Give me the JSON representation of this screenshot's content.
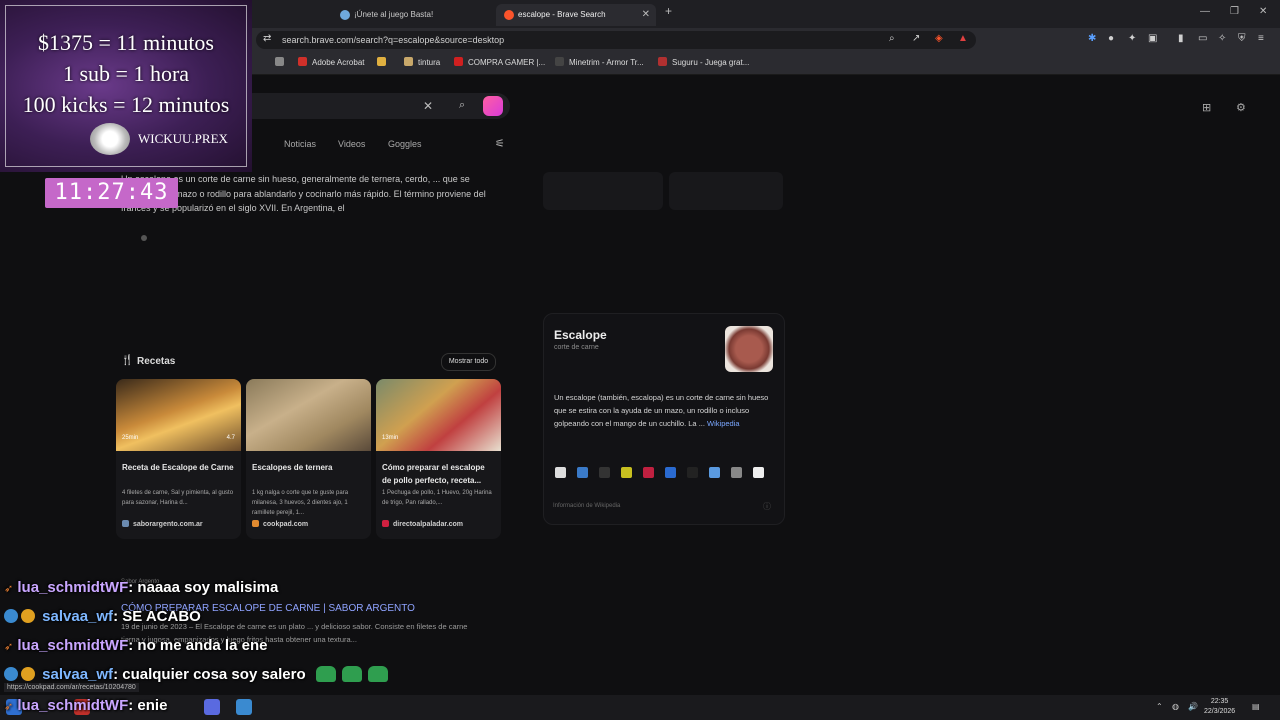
{
  "browser": {
    "tabs": [
      {
        "title": "¡Únete al juego Basta!",
        "active": false
      },
      {
        "title": "escalope - Brave Search",
        "active": true
      }
    ],
    "url": "search.brave.com/search?q=escalope&source=desktop",
    "bookmarks": [
      "Adobe Acrobat",
      "tintura",
      "COMPRA GAMER |...",
      "Minetrim - Armor Tr...",
      "Suguru - Juega grat..."
    ]
  },
  "search": {
    "tabs": [
      "Noticias",
      "Videos",
      "Goggles"
    ],
    "snippet": "Un escalope es un corte de carne sin hueso, generalmente de ternera, cerdo, ... que se estira con un mazo o rodillo para ablandarlo y cocinarlo más rápido. El término proviene del francés y se popularizó en el siglo XVII. En Argentina, el"
  },
  "recipes": {
    "title": "Recetas",
    "show_all": "Mostrar todo",
    "cards": [
      {
        "time": "25min",
        "rating": "4.7",
        "title": "Receta de Escalope de Carne",
        "desc": "4 filetes de carne, Sal y pimienta, al gusto para sazonar, Harina d...",
        "source": "saborargento.com.ar"
      },
      {
        "time": "",
        "rating": "",
        "title": "Escalopes de ternera",
        "desc": "1 kg nalga o corte que te guste para milanesa, 3 huevos, 2 dientes ajo, 1 ramillete perejil, 1...",
        "source": "cookpad.com"
      },
      {
        "time": "13min",
        "rating": "",
        "title": "Cómo preparar el escalope de pollo perfecto, receta...",
        "desc": "1 Pechuga de pollo, 1 Huevo, 20g Harina de trigo, Pan rallado,...",
        "source": "directoalpaladar.com"
      }
    ]
  },
  "knowledge": {
    "title": "Escalope",
    "subtitle": "corte de carne",
    "text": "Un escalope (también, escalopa) es un corte de carne sin hueso que se estira con la ayuda de un mazo, un rodillo o incluso golpeando con el mango de un cuchillo. La ...",
    "link": "Wikipedia",
    "footer": "Información de Wikipedia"
  },
  "result2": {
    "head": "Sabor Argento",
    "title": "CÓMO PREPARAR ESCALOPE DE CARNE | SABOR ARGENTO",
    "snippet": "19 de junio de 2023 – El Escalope de carne es un plato ... y delicioso sabor. Consiste en filetes de carne tierna y jugosa, empanizados y luego fritos hasta obtener una textura..."
  },
  "stream": {
    "line1": "$1375 = 11 minutos",
    "line2": "1 sub = 1 hora",
    "line3": "100 kicks = 12 minutos",
    "brand": "WICKUU.PREX",
    "timer": "11:27:43"
  },
  "chat": [
    {
      "user": "lua_schmidtWF",
      "msg": ": naaaa soy malisima",
      "color": "#c9a6ff"
    },
    {
      "user": "salvaa_wf",
      "msg": ": SE ACABO",
      "color": "#7eb7ff"
    },
    {
      "user": "lua_schmidtWF",
      "msg": ": no me anda la ene",
      "color": "#c9a6ff"
    },
    {
      "user": "salvaa_wf",
      "msg": ": cualquier cosa soy salero",
      "color": "#7eb7ff"
    },
    {
      "user": "lua_schmidtWF",
      "msg": ": enie",
      "color": "#c9a6ff"
    }
  ],
  "status_url": "https://cookpad.com/ar/recetas/10204780",
  "taskbar": {
    "time": "22:35",
    "date": "22/3/2026"
  },
  "colors": {
    "accent": "#c568c9",
    "link": "#7aa7ff",
    "brave": "#fb542b"
  }
}
